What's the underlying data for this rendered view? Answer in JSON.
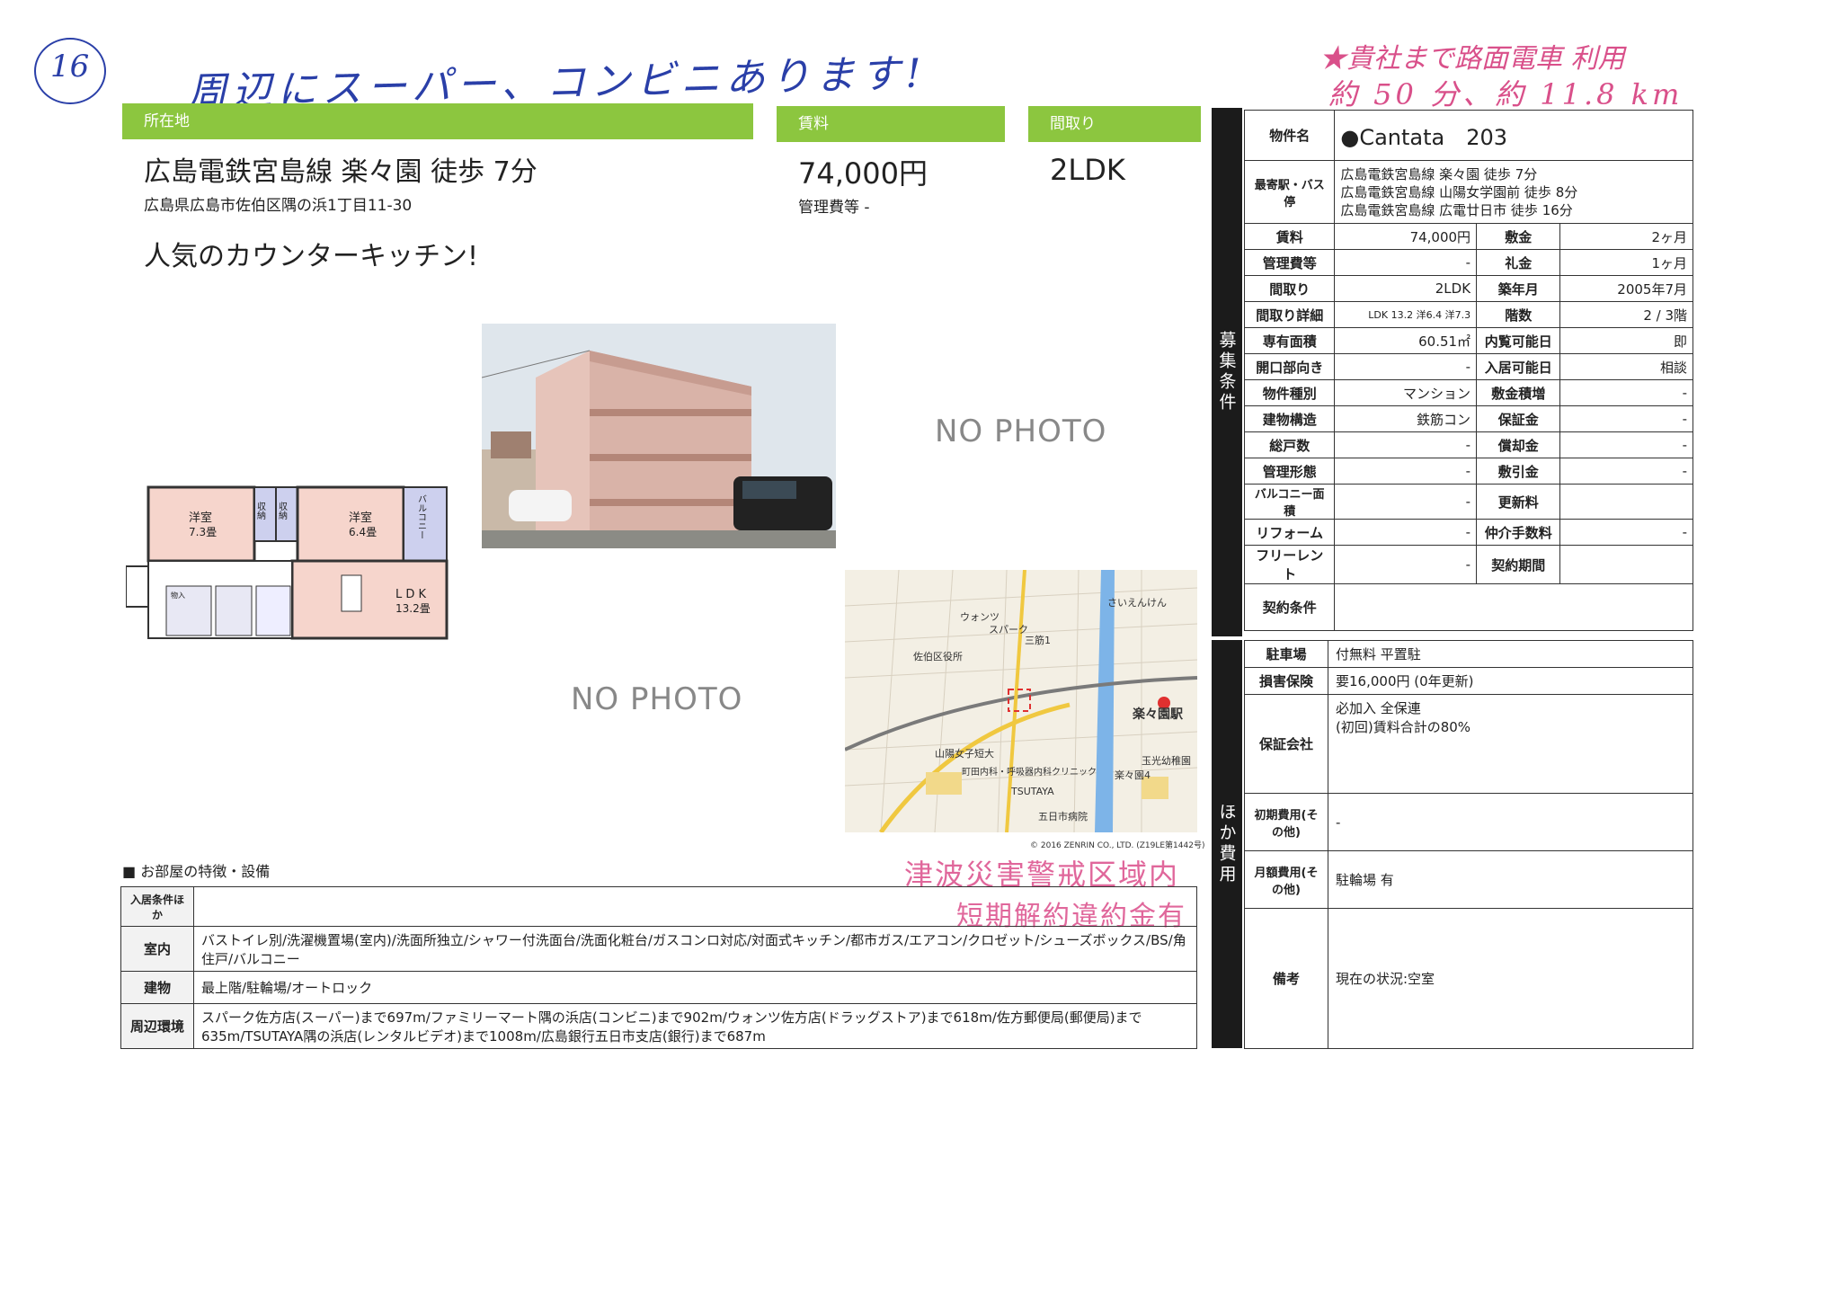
{
  "handwritten": {
    "page_number": "16",
    "note_top": "周辺にスーパー、コンビニあります!",
    "note_right_line1": "★貴社まで路面電車 利用",
    "note_right_line2": "約 50 分、約 11.8 km"
  },
  "headers": {
    "location": "所在地",
    "rent": "賃料",
    "layout": "間取り"
  },
  "summary": {
    "station": "広島電鉄宮島線 楽々園 徒歩 7分",
    "address": "広島県広島市佐伯区隅の浜1丁目11-30",
    "rent": "74,000円",
    "mgmt_fee": "管理費等 -",
    "layout": "2LDK",
    "catch": "人気のカウンターキッチン!"
  },
  "photos": {
    "no_photo_1": "NO PHOTO",
    "no_photo_2": "NO PHOTO"
  },
  "floorplan": {
    "room1": "洋室",
    "room1_size": "7.3畳",
    "room2": "洋室",
    "room2_size": "6.4畳",
    "ldk": "L D K",
    "ldk_size": "13.2畳",
    "closet": "収納",
    "balcony": "バルコニー",
    "storage": "物入"
  },
  "map": {
    "station": "楽々園駅",
    "labels": [
      "さいえんけん",
      "ウォンツ",
      "スパーク",
      "山陽女子短大",
      "楽々園4",
      "TSUTAYA",
      "五日市病院",
      "玉光幼稚園",
      "町田内科・呼吸器内科クリニック",
      "三筋1",
      "佐伯区役所"
    ],
    "copyright": "© 2016 ZENRIN CO., LTD. (Z19LE第1442号)"
  },
  "stamps": {
    "line1": "津波災害警戒区域内",
    "line2": "短期解約違約金有"
  },
  "features": {
    "heading": "■ お部屋の特徴・設備",
    "rows": [
      {
        "label": "入居条件ほか",
        "value": ""
      },
      {
        "label": "室内",
        "value": "バストイレ別/洗濯機置場(室内)/洗面所独立/シャワー付洗面台/洗面化粧台/ガスコンロ対応/対面式キッチン/都市ガス/エアコン/クロゼット/シューズボックス/BS/角住戸/バルコニー"
      },
      {
        "label": "建物",
        "value": "最上階/駐輪場/オートロック"
      },
      {
        "label": "周辺環境",
        "value": "スパーク佐方店(スーパー)まで697m/ファミリーマート隅の浜店(コンビニ)まで902m/ウォンツ佐方店(ドラッグストア)まで618m/佐方郵便局(郵便局)まで635m/TSUTAYA隅の浜店(レンタルビデオ)まで1008m/広島銀行五日市支店(銀行)まで687m"
      }
    ]
  },
  "spec": {
    "side_label": "募集条件",
    "property_name_label": "物件名",
    "property_name": "●Cantata　203",
    "station_label": "最寄駅・バス停",
    "stations": [
      "広島電鉄宮島線 楽々園 徒歩 7分",
      "広島電鉄宮島線 山陽女学園前 徒歩 8分",
      "広島電鉄宮島線 広電廿日市 徒歩 16分"
    ],
    "rows": [
      {
        "l1": "賃料",
        "v1": "74,000円",
        "l2": "敷金",
        "v2": "2ヶ月"
      },
      {
        "l1": "管理費等",
        "v1": "-",
        "l2": "礼金",
        "v2": "1ヶ月"
      },
      {
        "l1": "間取り",
        "v1": "2LDK",
        "l2": "築年月",
        "v2": "2005年7月"
      },
      {
        "l1": "間取り詳細",
        "v1": "LDK 13.2 洋6.4 洋7.3",
        "l2": "階数",
        "v2": "2 / 3階"
      },
      {
        "l1": "専有面積",
        "v1": "60.51㎡",
        "l2": "内覧可能日",
        "v2": "即"
      },
      {
        "l1": "開口部向き",
        "v1": "-",
        "l2": "入居可能日",
        "v2": "相談"
      },
      {
        "l1": "物件種別",
        "v1": "マンション",
        "l2": "敷金積増",
        "v2": "-"
      },
      {
        "l1": "建物構造",
        "v1": "鉄筋コン",
        "l2": "保証金",
        "v2": "-"
      },
      {
        "l1": "総戸数",
        "v1": "-",
        "l2": "償却金",
        "v2": "-"
      },
      {
        "l1": "管理形態",
        "v1": "-",
        "l2": "敷引金",
        "v2": "-"
      },
      {
        "l1": "バルコニー面積",
        "v1": "-",
        "l2": "更新料",
        "v2": ""
      },
      {
        "l1": "リフォーム",
        "v1": "-",
        "l2": "仲介手数料",
        "v2": "-"
      },
      {
        "l1": "フリーレント",
        "v1": "-",
        "l2": "契約期間",
        "v2": ""
      }
    ],
    "contract_label": "契約条件",
    "contract_value": ""
  },
  "other": {
    "side_label": "ほか費用",
    "rows": [
      {
        "label": "駐車場",
        "value": "付無料 平置駐"
      },
      {
        "label": "損害保険",
        "value": "要16,000円 (0年更新)"
      },
      {
        "label": "保証会社",
        "value": "必加入 全保連\n(初回)賃料合計の80%"
      },
      {
        "label": "初期費用(その他)",
        "value": "-"
      },
      {
        "label": "月額費用(その他)",
        "value": "駐輪場 有"
      },
      {
        "label": "備考",
        "value": "現在の状況:空室"
      }
    ]
  },
  "colors": {
    "header_green": "#8cc63f",
    "side_black": "#1b1b1b",
    "stamp_pink": "#e0679b",
    "handwriting_blue": "#2a3fa8"
  }
}
